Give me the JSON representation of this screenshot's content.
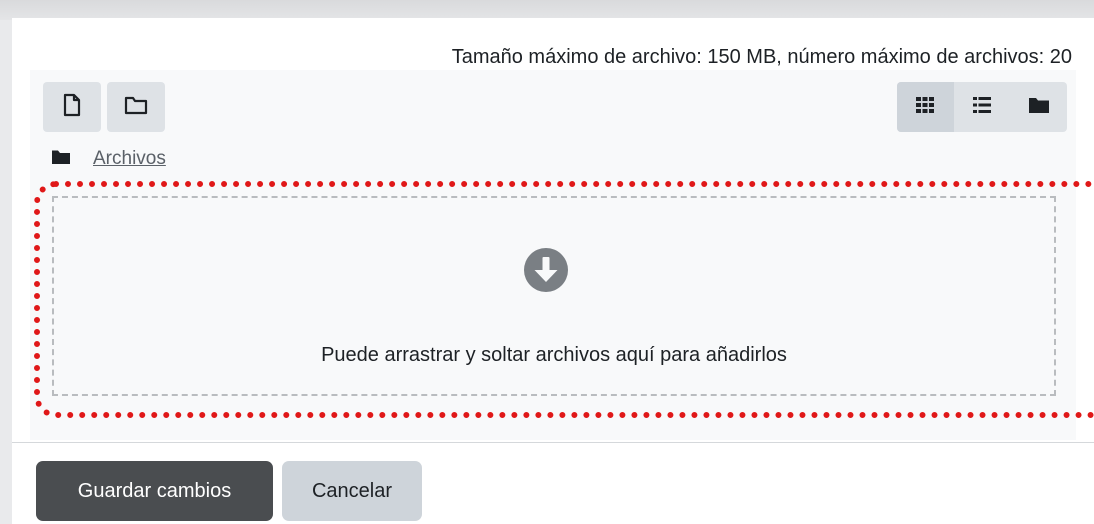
{
  "filemanager": {
    "max_info": "Tamaño máximo de archivo: 150 MB, número máximo de archivos: 20",
    "toolbar": {
      "add_file_icon": "file-icon",
      "create_folder_icon": "folder-outline-icon",
      "views": [
        {
          "icon": "grid-icon",
          "active": true
        },
        {
          "icon": "list-icon",
          "active": false
        },
        {
          "icon": "folder-icon",
          "active": false
        }
      ]
    },
    "breadcrumb": {
      "icon": "folder-icon",
      "label": "Archivos"
    },
    "dropzone": {
      "icon": "arrow-circle-down-icon",
      "text": "Puede arrastrar y soltar archivos aquí para añadirlos"
    }
  },
  "actions": {
    "save_label": "Guardar cambios",
    "cancel_label": "Cancelar"
  },
  "colors": {
    "highlight": "#e01818",
    "primary_button": "#4a4d50",
    "secondary_button": "#ced4da"
  }
}
